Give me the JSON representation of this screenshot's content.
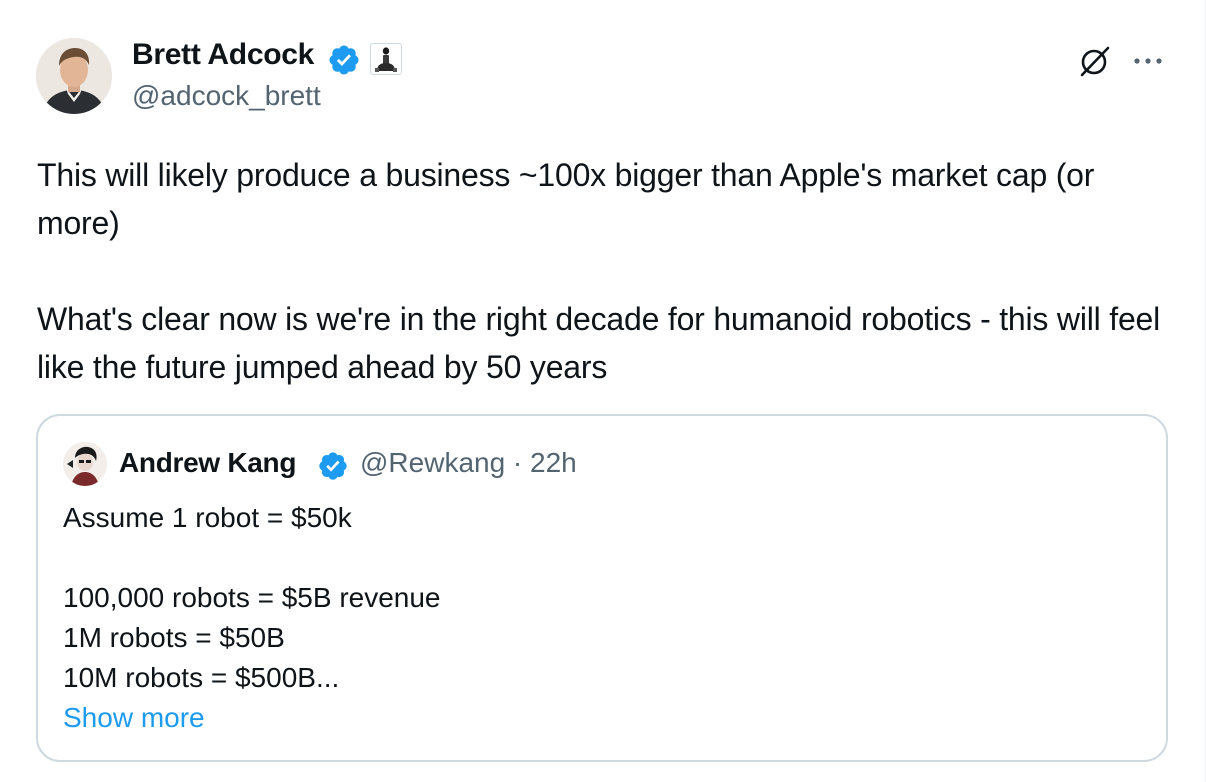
{
  "post": {
    "author": {
      "name": "Brett Adcock",
      "handle": "@adcock_brett",
      "verified": true,
      "affiliate_badge_icon": "figure-robot-affiliate-icon"
    },
    "text_lines": [
      "This will likely produce a business ~100x bigger than Apple's market cap (or more)",
      "What's clear now is we're in the right decade for humanoid robotics - this will feel like the future jumped ahead by 50 years"
    ],
    "actions": {
      "grok_icon": "grok-slash-circle-icon",
      "more_icon": "more-dots-icon"
    }
  },
  "quote": {
    "author": {
      "name": "Andrew Kang",
      "handle": "@Rewkang",
      "time": "22h",
      "verified": true
    },
    "meta": "@Rewkang · 22h",
    "lines": [
      "Assume 1 robot = $50k",
      "100,000 robots = $5B revenue",
      "1M robots = $50B",
      "10M robots = $500B..."
    ],
    "show_more": "Show more"
  },
  "colors": {
    "text": "#0f1419",
    "secondary": "#536471",
    "link": "#1d9bf0",
    "verified": "#1d9bf0",
    "border": "#cfd9de"
  }
}
